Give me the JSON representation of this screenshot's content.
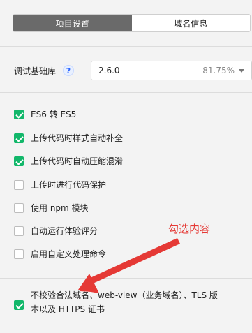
{
  "tabs": [
    {
      "label": "项目设置",
      "active": true
    },
    {
      "label": "域名信息",
      "active": false
    }
  ],
  "debug": {
    "label": "调试基础库",
    "help_icon": "question-mark-icon",
    "version": "2.6.0",
    "percent": "81.75%"
  },
  "options": [
    {
      "label": "ES6 转 ES5",
      "checked": true
    },
    {
      "label": "上传代码时样式自动补全",
      "checked": true
    },
    {
      "label": "上传代码时自动压缩混淆",
      "checked": true
    },
    {
      "label": "上传时进行代码保护",
      "checked": false
    },
    {
      "label": "使用 npm 模块",
      "checked": false
    },
    {
      "label": "自动运行体验评分",
      "checked": false
    },
    {
      "label": "启用自定义处理命令",
      "checked": false
    }
  ],
  "bottom_option": {
    "line1": "不校验合法域名、web-view（业务域名）、TLS 版",
    "line2": "本以及 HTTPS 证书",
    "checked": true
  },
  "annotation": {
    "text": "勾选内容",
    "color": "#e53935"
  },
  "colors": {
    "check": "#12b76a",
    "active_tab": "#6a6a6a"
  }
}
